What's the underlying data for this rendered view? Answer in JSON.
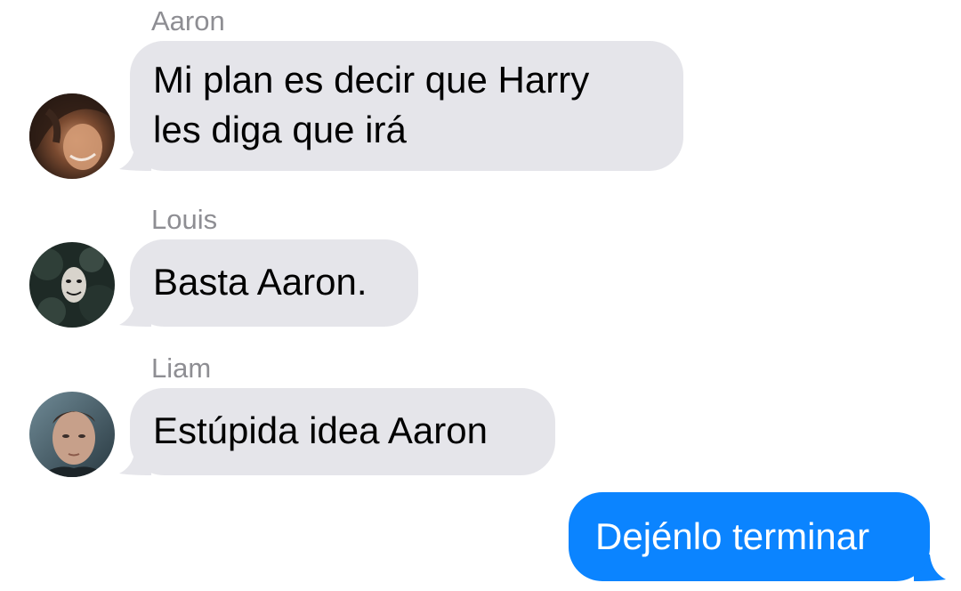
{
  "messages": [
    {
      "sender": "Aaron",
      "text_lines": [
        "Mi plan es decir que Harry",
        "les diga que irá"
      ],
      "avatar": "aaron-avatar-icon"
    },
    {
      "sender": "Louis",
      "text_lines": [
        "Basta Aaron."
      ],
      "avatar": "louis-avatar-icon"
    },
    {
      "sender": "Liam",
      "text_lines": [
        "Estúpida idea Aaron"
      ],
      "avatar": "liam-avatar-icon"
    }
  ],
  "outgoing": {
    "text": "Dejénlo terminar"
  },
  "colors": {
    "incoming_bubble": "#e5e5ea",
    "outgoing_bubble": "#0b84ff",
    "sender_name": "#8e8e93"
  }
}
